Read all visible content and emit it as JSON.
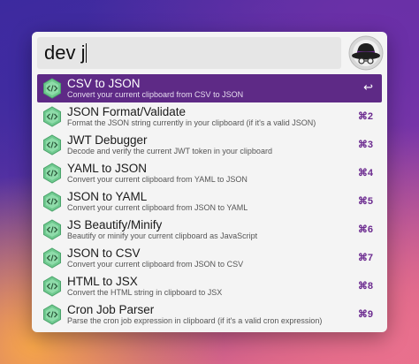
{
  "search": {
    "query": "dev j"
  },
  "results": [
    {
      "title": "CSV to JSON",
      "subtitle": "Convert your current clipboard from CSV to JSON",
      "shortcut": "↩",
      "selected": true
    },
    {
      "title": "JSON Format/Validate",
      "subtitle": "Format the JSON string currently in your clipboard (if it's a valid JSON)",
      "shortcut": "⌘2"
    },
    {
      "title": "JWT Debugger",
      "subtitle": "Decode and verify the current JWT token in your clipboard",
      "shortcut": "⌘3"
    },
    {
      "title": "YAML to JSON",
      "subtitle": "Convert your current clipboard from YAML to JSON",
      "shortcut": "⌘4"
    },
    {
      "title": "JSON to YAML",
      "subtitle": "Convert your current clipboard from JSON to YAML",
      "shortcut": "⌘5"
    },
    {
      "title": "JS Beautify/Minify",
      "subtitle": "Beautify or minify your current clipboard as JavaScript",
      "shortcut": "⌘6"
    },
    {
      "title": "JSON to CSV",
      "subtitle": "Convert your current clipboard from JSON to CSV",
      "shortcut": "⌘7"
    },
    {
      "title": "HTML to JSX",
      "subtitle": "Convert the HTML string in clipboard to JSX",
      "shortcut": "⌘8"
    },
    {
      "title": "Cron Job Parser",
      "subtitle": "Parse the cron job expression in clipboard (if it's a valid cron expression)",
      "shortcut": "⌘9"
    }
  ],
  "colors": {
    "selected": "#5e2a86",
    "shortcut": "#6b2a8f",
    "icon": "#6fc98f"
  },
  "icons": {
    "result": "code-tag-icon",
    "logo": "alfred-hat-icon"
  }
}
